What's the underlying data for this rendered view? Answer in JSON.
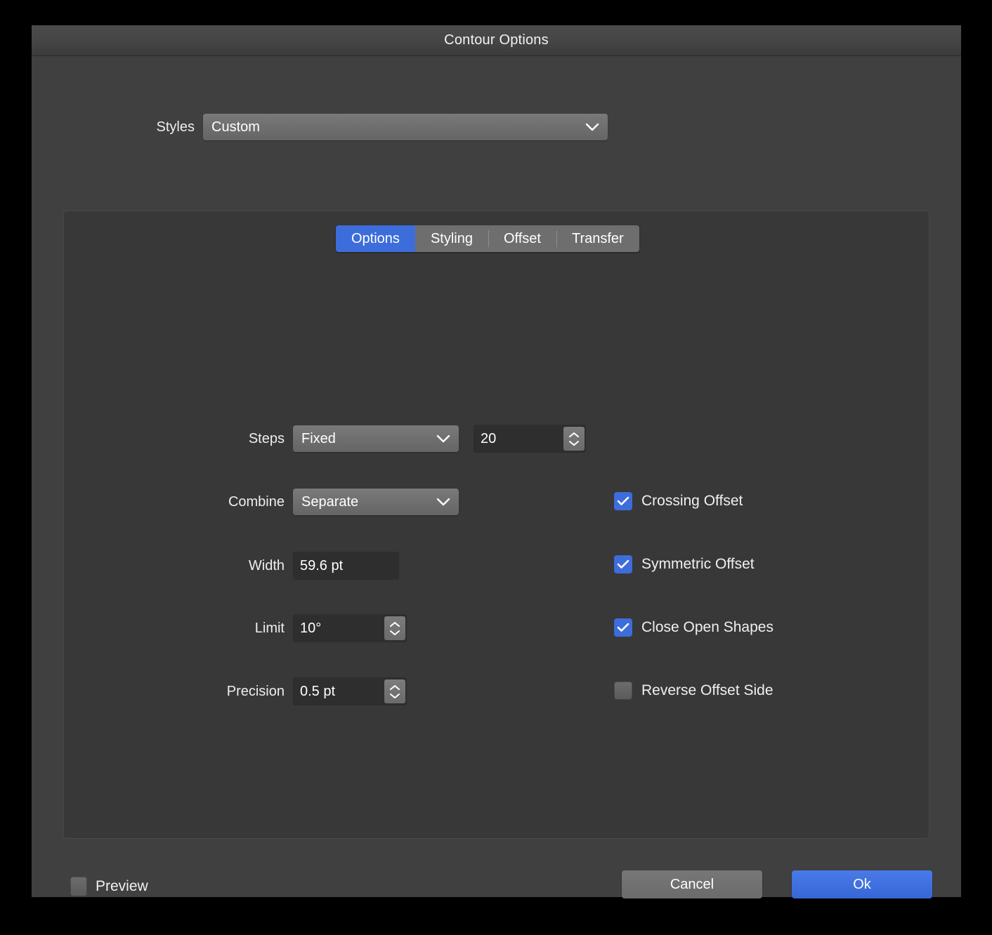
{
  "window": {
    "title": "Contour Options"
  },
  "styles": {
    "label": "Styles",
    "value": "Custom",
    "chevron_icon": "chevron-down-icon"
  },
  "tabs": [
    {
      "label": "Options",
      "active": true
    },
    {
      "label": "Styling",
      "active": false
    },
    {
      "label": "Offset",
      "active": false
    },
    {
      "label": "Transfer",
      "active": false
    }
  ],
  "options_tab": {
    "fields": [
      {
        "label": "Steps",
        "value": "Fixed",
        "type": "popup"
      },
      {
        "label": "",
        "value": "20",
        "type": "number-stepper"
      },
      {
        "label": "Combine",
        "value": "Separate",
        "type": "popup"
      },
      {
        "label": "Width",
        "value": "59.6 pt",
        "type": "text"
      },
      {
        "label": "Limit",
        "value": "10°",
        "type": "number-stepper"
      },
      {
        "label": "Precision",
        "value": "0.5 pt",
        "type": "number-stepper"
      }
    ],
    "steps_label": "Steps",
    "steps_value": "Fixed",
    "steps_count": "20",
    "combine_label": "Combine",
    "combine_value": "Separate",
    "width_label": "Width",
    "width_value": "59.6 pt",
    "limit_label": "Limit",
    "limit_value": "10°",
    "precision_label": "Precision",
    "precision_value": "0.5 pt",
    "checkboxes": [
      {
        "label": "Crossing Offset",
        "checked": true
      },
      {
        "label": "Symmetric Offset",
        "checked": true
      },
      {
        "label": "Close Open Shapes",
        "checked": true
      },
      {
        "label": "Reverse Offset Side",
        "checked": false
      }
    ]
  },
  "footer": {
    "preview_label": "Preview",
    "preview_checked": false,
    "cancel_label": "Cancel",
    "ok_label": "Ok"
  },
  "colors": {
    "accent": "#3d6ddb",
    "window_bg": "#404040",
    "panel_bg": "#383838",
    "field_bg": "#2e2e2e",
    "control_gray": "#6e6e6e",
    "text": "#ffffff"
  }
}
